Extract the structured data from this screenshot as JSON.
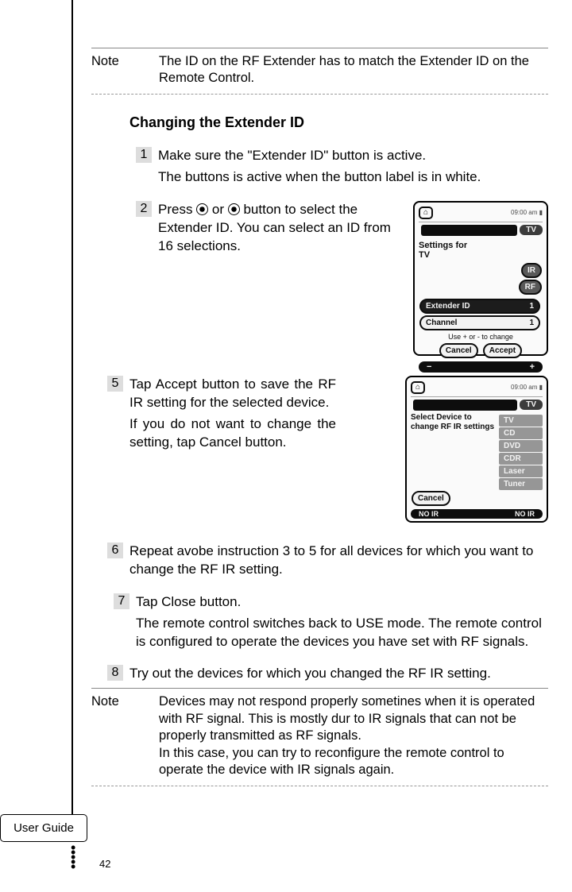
{
  "tab_label": "User Guide",
  "page_number": "42",
  "note_top": {
    "label": "Note",
    "text": "The ID on the RF Extender has to match the Extender ID on the Remote Control."
  },
  "section_title": "Changing the Extender ID",
  "steps": {
    "s1": {
      "num": "1",
      "line1": "Make sure the \"Extender ID\" button is active.",
      "line2": "The buttons is active when the button label is in white."
    },
    "s2": {
      "num": "2",
      "pre": "Press ",
      "mid": " or ",
      "post": " button to select the Extender ID. You can select an ID from 16 selections."
    },
    "s5": {
      "num": "5",
      "p1": "Tap Accept button to save the RF IR setting for the selected device.",
      "p2": "If you do not want to change the setting, tap Cancel button."
    },
    "s6": {
      "num": "6",
      "text": "Repeat avobe instruction 3 to 5 for all devices for which you want to change the RF IR setting."
    },
    "s7": {
      "num": "7",
      "line1": "Tap Close button.",
      "line2": "The remote control switches back to USE mode. The remote control is configured to operate the devices you have set with RF signals."
    },
    "s8": {
      "num": "8",
      "text": "Try out the devices for which you changed the RF IR setting."
    }
  },
  "note_bottom": {
    "label": "Note",
    "p1": "Devices may not respond properly sometines when it is operated with RF signal. This is  mostly dur to IR signals that can not be properly transmitted as RF signals.",
    "p2": "In this case, you can try to reconfigure the remote control to operate the device with IR signals again."
  },
  "fig1": {
    "settings_for": "Settings for",
    "tv": "TV",
    "ir": "IR",
    "rf": "RF",
    "extender_id": "Extender ID",
    "ext_val": "1",
    "channel": "Channel",
    "ch_val": "1",
    "hint": "Use + or - to change",
    "cancel": "Cancel",
    "accept": "Accept",
    "minus": "−",
    "plus": "+"
  },
  "fig2": {
    "tv": "TV",
    "select_device": "Select Device to change RF IR settings",
    "devices": [
      "TV",
      "CD",
      "DVD",
      "CDR",
      "Laser",
      "Tuner"
    ],
    "cancel": "Cancel",
    "no_ir": "NO IR",
    "no_rf": "NO IR"
  }
}
